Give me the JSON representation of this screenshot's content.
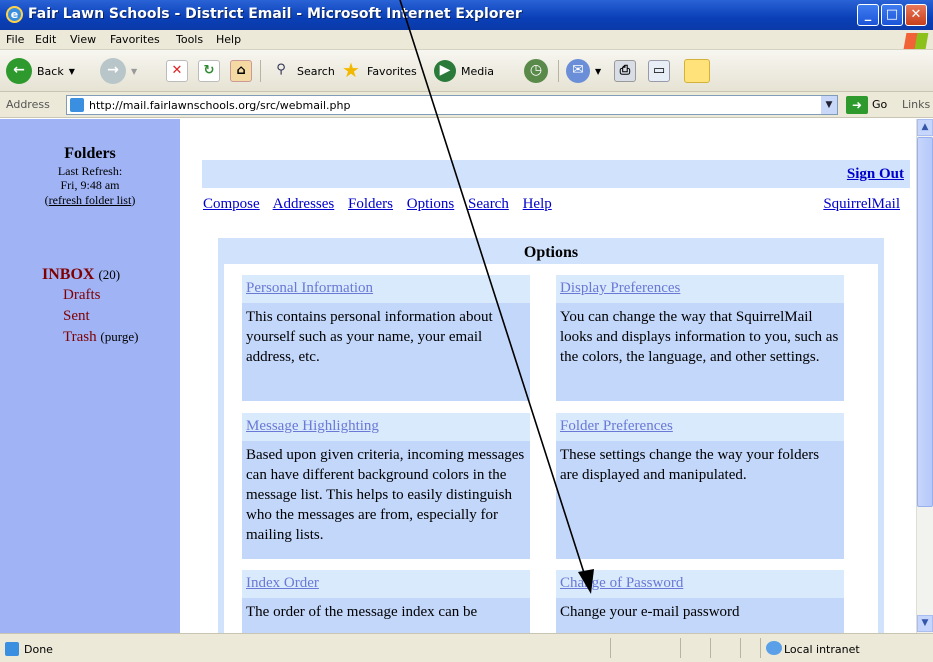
{
  "window": {
    "title": "Fair Lawn Schools - District Email - Microsoft Internet Explorer",
    "minimize": "_",
    "maximize": "□",
    "close": "✕"
  },
  "menu": [
    "File",
    "Edit",
    "View",
    "Favorites",
    "Tools",
    "Help"
  ],
  "toolbar": {
    "back": "Back",
    "search": "Search",
    "favorites": "Favorites",
    "media": "Media"
  },
  "address": {
    "label": "Address",
    "url": "http://mail.fairlawnschools.org/src/webmail.php",
    "go": "Go",
    "links": "Links"
  },
  "sidebar": {
    "heading": "Folders",
    "last_refresh_label": "Last Refresh:",
    "last_refresh_time": "Fri, 9:48 am",
    "refresh_link": "refresh folder list",
    "inbox": "INBOX",
    "inbox_count": "(20)",
    "folders": [
      "Drafts",
      "Sent",
      "Trash"
    ],
    "purge": "(purge)"
  },
  "main": {
    "sign_out": "Sign Out",
    "nav": [
      "Compose",
      "Addresses",
      "Folders",
      "Options",
      "Search",
      "Help"
    ],
    "brand_link": "SquirrelMail",
    "options_title": "Options",
    "cards": [
      {
        "title": "Personal Information",
        "desc": "This contains personal information about yourself such as your name, your email address, etc."
      },
      {
        "title": "Display Preferences",
        "desc": "You can change the way that SquirrelMail looks and displays information to you, such as the colors, the language, and other settings."
      },
      {
        "title": "Message Highlighting",
        "desc": "Based upon given criteria, incoming messages can have different background colors in the message list. This helps to easily distinguish who the messages are from, especially for mailing lists."
      },
      {
        "title": "Folder Preferences",
        "desc": "These settings change the way your folders are displayed and manipulated."
      },
      {
        "title": "Index Order",
        "desc": "The order of the message index can be"
      },
      {
        "title": "Change of Password",
        "desc": "Change your e-mail password"
      }
    ]
  },
  "status": {
    "text": "Done",
    "zone": "Local intranet"
  },
  "colors": {
    "titlebar": "#0a3fb8",
    "sidebar_bg": "#9fb3f5",
    "link": "#0000cc",
    "card_head": "#d9eafd",
    "card_body": "#c3d7fb"
  }
}
